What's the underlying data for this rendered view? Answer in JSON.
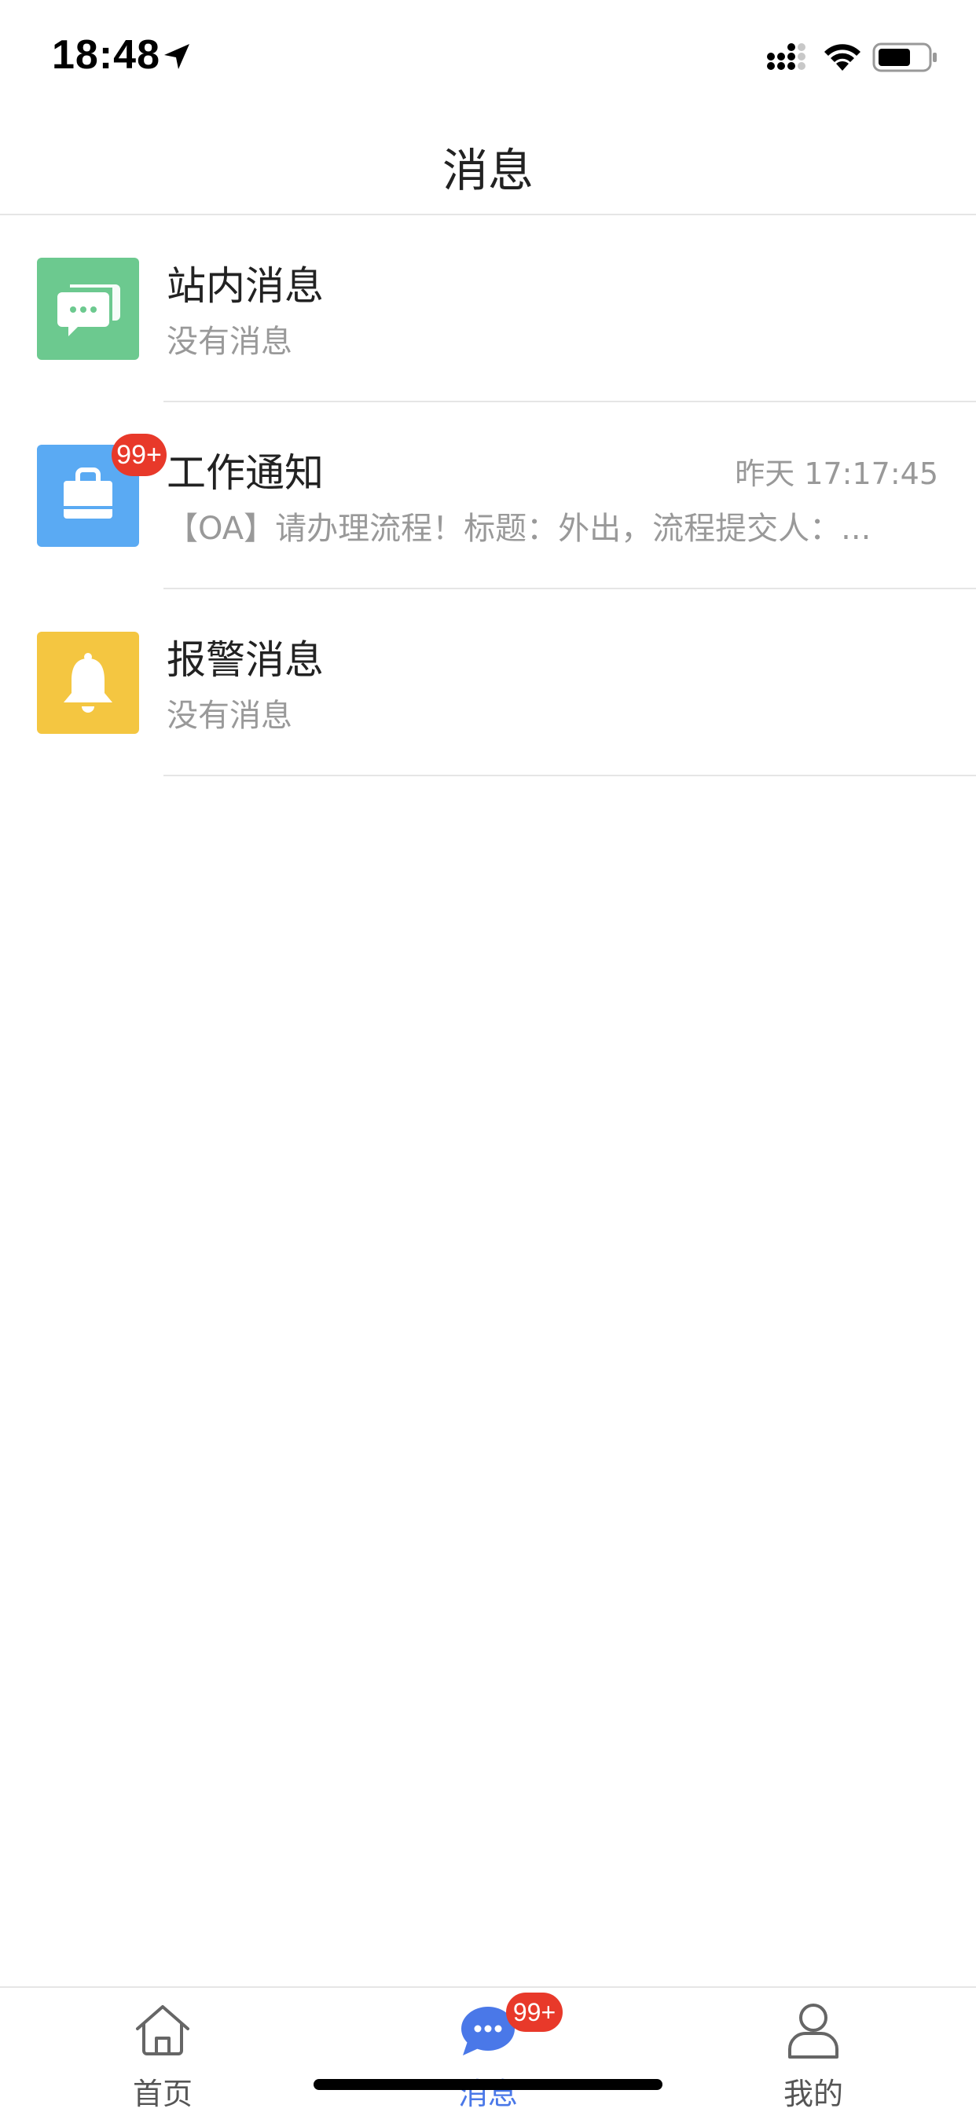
{
  "status_bar": {
    "time": "18:48"
  },
  "nav": {
    "title": "消息"
  },
  "messages": [
    {
      "title": "站内消息",
      "subtitle": "没有消息",
      "time": "",
      "badge": "",
      "icon": "chat-bubbles-icon",
      "color": "#6cc98f"
    },
    {
      "title": "工作通知",
      "subtitle": "【OA】请办理流程！标题：外出，流程提交人：...",
      "time": "昨天 17:17:45",
      "badge": "99+",
      "icon": "briefcase-icon",
      "color": "#5aaaf3"
    },
    {
      "title": "报警消息",
      "subtitle": "没有消息",
      "time": "",
      "badge": "",
      "icon": "bell-icon",
      "color": "#f4c641"
    }
  ],
  "tabs": [
    {
      "label": "首页",
      "icon": "home-icon"
    },
    {
      "label": "消息",
      "icon": "message-icon",
      "badge": "99+"
    },
    {
      "label": "我的",
      "icon": "user-icon"
    }
  ],
  "colors": {
    "accent": "#4a78e8",
    "badge": "#e8392a"
  }
}
